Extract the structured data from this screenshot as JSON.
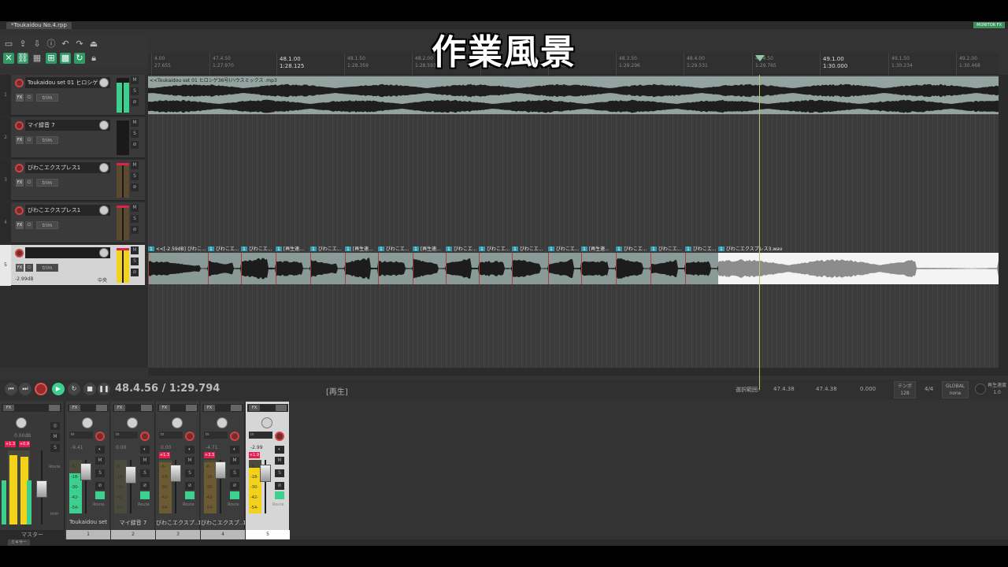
{
  "window": {
    "tab_title": "*Toukaidou No.4.rpp",
    "monitor_fx": "MONITOR FX"
  },
  "caption": "作業風景",
  "ruler": {
    "marks": [
      {
        "bar": "4.00",
        "time": "27.655",
        "major": false
      },
      {
        "bar": "47.4.50",
        "time": "1:27.970",
        "major": false
      },
      {
        "bar": "48.1.00",
        "time": "1:28.125",
        "major": true
      },
      {
        "bar": "48.1.50",
        "time": "1:28.359",
        "major": false
      },
      {
        "bar": "48.2.00",
        "time": "1:28.593",
        "major": false
      },
      {
        "bar": "48.2.50",
        "time": "1:28.828",
        "major": false
      },
      {
        "bar": "48.3.00",
        "time": "1:29.062",
        "major": false
      },
      {
        "bar": "48.3.50",
        "time": "1:29.296",
        "major": false
      },
      {
        "bar": "48.4.00",
        "time": "1:29.531",
        "major": false
      },
      {
        "bar": "48.4.50",
        "time": "1:29.765",
        "major": false
      },
      {
        "bar": "49.1.00",
        "time": "1:30.000",
        "major": true
      },
      {
        "bar": "49.1.50",
        "time": "1:30.234",
        "major": false
      },
      {
        "bar": "49.2.00",
        "time": "1:30.468",
        "major": false
      }
    ]
  },
  "tracks": [
    {
      "num": "1",
      "name": "Toukaidou set 01 ヒロシゲ",
      "fx": "FX",
      "trim": "trim",
      "db": "",
      "pan": ""
    },
    {
      "num": "2",
      "name": "マイ録音 7",
      "fx": "FX",
      "trim": "trim",
      "db": "",
      "pan": ""
    },
    {
      "num": "3",
      "name": "びわこエクスプレス1",
      "fx": "FX",
      "trim": "trim",
      "db": "",
      "pan": ""
    },
    {
      "num": "4",
      "name": "びわこエクスプレス1",
      "fx": "FX",
      "trim": "trim",
      "db": "",
      "pan": ""
    },
    {
      "num": "5",
      "name": "",
      "fx": "FX",
      "trim": "trim",
      "db": "-2.99dB",
      "pan": "中央"
    }
  ],
  "track_buttons": {
    "m": "M",
    "s": "S",
    "phase": "⊘"
  },
  "items": {
    "track1_label": "<<Toukaidou set 01 ヒロシゲ36号(ハウスミックス .mp3",
    "track5_segments": [
      "<<[-2.59dB] びわこ...",
      "びわこエ...",
      "びわこエ...",
      "[再生速...",
      "びわこエ...",
      "[再生速...",
      "びわこエ...",
      "[再生速...",
      "びわこエ...",
      "びわこエ...",
      "びわこエ...",
      "びわこエ...",
      "[再生速...",
      "びわこエ...",
      "びわこエ...",
      "びわこエ..."
    ],
    "track5_last": "びわこエクスプレス3.wav"
  },
  "transport": {
    "time": "48.4.56 / 1:29.794",
    "status": "[再生]",
    "selection_label": "選択範囲:",
    "sel_start": "47.4.38",
    "sel_end": "47.4.38",
    "sel_len": "0.000",
    "tempo_label": "テンポ",
    "tempo": "128",
    "timesig": "4/4",
    "global_label": "GLOBAL",
    "global_value": "none",
    "rate_label": "再生速度",
    "rate_value": "1.0"
  },
  "mixer": {
    "master": {
      "label": "マスター",
      "db": "0.00dB",
      "peak_l": "+1.3",
      "peak_r": "+0.9",
      "route": "Route",
      "trim": "trim"
    },
    "strips": [
      {
        "name": "Toukaidou set",
        "num": "1",
        "db": "-9.41",
        "peak": "",
        "selected": false
      },
      {
        "name": "マイ録音 7",
        "num": "2",
        "db": "0.00",
        "peak": "",
        "selected": false
      },
      {
        "name": "びわこエクスプ..1",
        "num": "3",
        "db": "0.00",
        "peak": "+1.3",
        "selected": false
      },
      {
        "name": "びわこエクスプ..1",
        "num": "4",
        "db": "-4.71",
        "peak": "+3.3",
        "selected": false
      },
      {
        "name": "",
        "num": "5",
        "db": "-2.99",
        "peak": "+1.9",
        "selected": true
      }
    ],
    "fx": "FX",
    "in": "in",
    "route": "Route",
    "meter_scale": [
      "-6-",
      "-18-",
      "-30-",
      "-42-",
      "-54-"
    ]
  },
  "bottom": {
    "mixer_tab": "ミキサー"
  },
  "colors": {
    "accent_green": "#3ccf8e",
    "record_red": "#dd5555",
    "meter_yellow": "#f2d21b",
    "peak_red": "#e02050"
  }
}
